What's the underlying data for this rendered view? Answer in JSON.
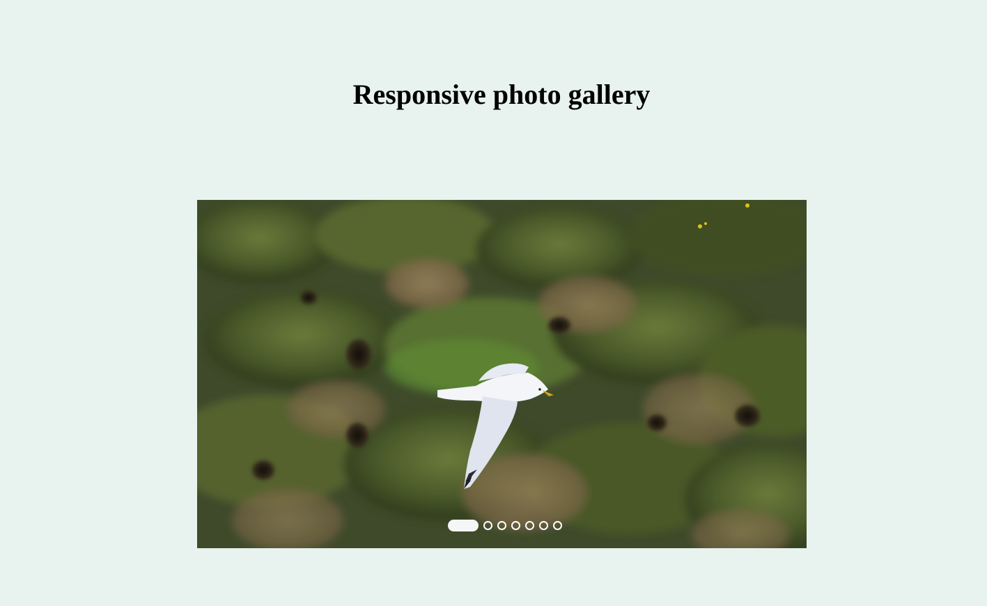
{
  "page": {
    "title": "Responsive photo gallery"
  },
  "gallery": {
    "slide_count": 7,
    "active_slide": 1,
    "current_slide_subject": "seagull in flight over grassy cliff",
    "colors": {
      "background": "#e8f2ee",
      "indicator": "#ffffff"
    }
  }
}
